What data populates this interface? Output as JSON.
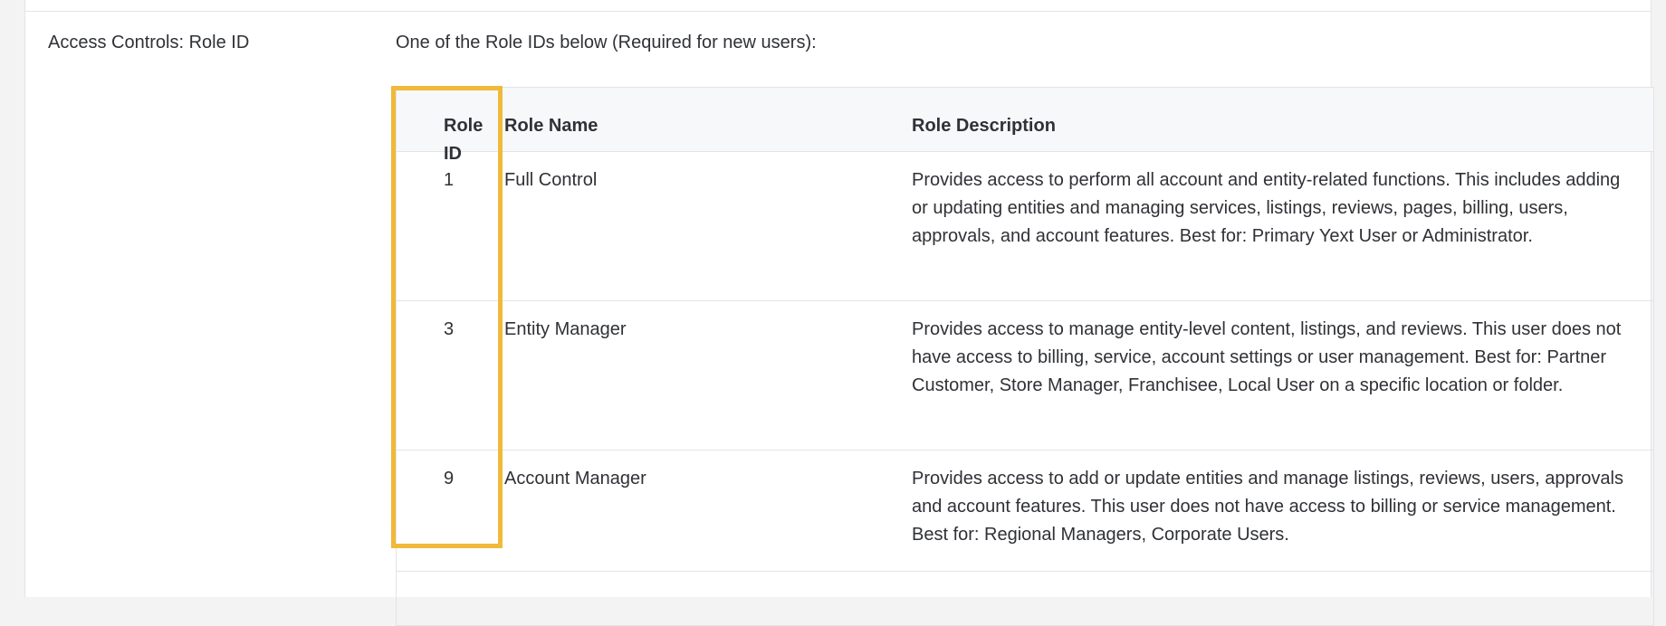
{
  "field": {
    "label": "Access Controls: Role ID",
    "help_text": "One of the Role IDs below (Required for new users):"
  },
  "table": {
    "headers": {
      "role_id": "Role ID",
      "role_name": "Role Name",
      "role_description": "Role Description"
    },
    "rows": [
      {
        "role_id": "1",
        "role_name": "Full Control",
        "role_description": "Provides access to perform all account and entity-related functions. This includes adding or updating entities and managing services, listings, reviews, pages, billing, users, approvals, and account features. Best for: Primary Yext User or Administrator."
      },
      {
        "role_id": "3",
        "role_name": "Entity Manager",
        "role_description": "Provides access to manage entity-level content, listings, and reviews. This user does not have access to billing, service, account settings or user management. Best for: Partner Customer, Store Manager, Franchisee, Local User on a specific location or folder."
      },
      {
        "role_id": "9",
        "role_name": "Account Manager",
        "role_description": "Provides access to add or update entities and manage listings, reviews, users, approvals and account features. This user does not have access to billing or service management. Best for: Regional Managers, Corporate Users."
      }
    ]
  },
  "colors": {
    "highlight": "#f0b93a",
    "header_bg": "#f7f8fa",
    "border": "#e3e4e8"
  }
}
